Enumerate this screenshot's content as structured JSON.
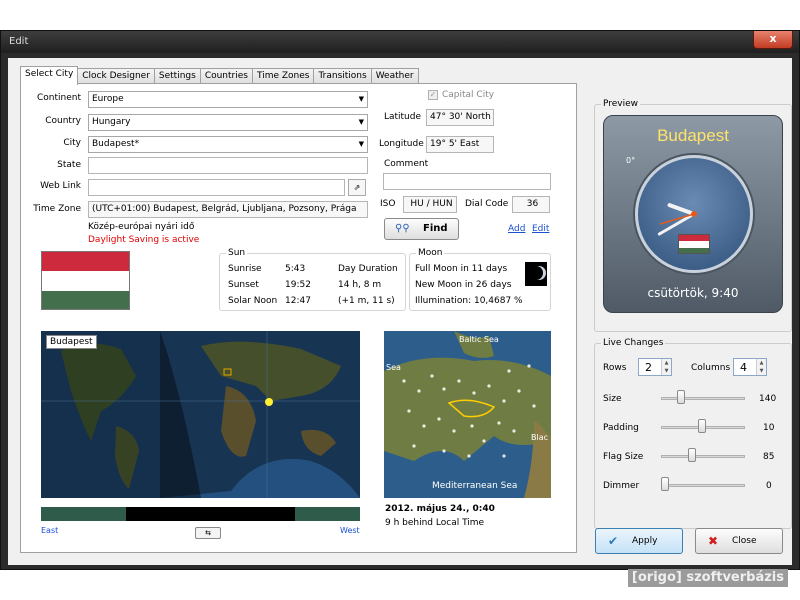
{
  "window": {
    "title": "Edit",
    "close_glyph": "x"
  },
  "tabs": [
    "Select City",
    "Clock Designer",
    "Settings",
    "Countries",
    "Time Zones",
    "Transitions",
    "Weather"
  ],
  "form": {
    "continent_label": "Continent",
    "continent_value": "Europe",
    "country_label": "Country",
    "country_value": "Hungary",
    "city_label": "City",
    "city_value": "Budapest*",
    "state_label": "State",
    "state_value": "",
    "weblink_label": "Web Link",
    "weblink_value": "",
    "timezone_label": "Time Zone",
    "timezone_value": "(UTC+01:00) Budapest, Belgrád, Ljubljana, Pozsony, Prága",
    "tz_name": "Közép-európai nyári idő",
    "dst_text": "Daylight Saving is active",
    "capital_label": "Capital City",
    "latitude_label": "Latitude",
    "latitude_value": "47° 30' North",
    "longitude_label": "Longitude",
    "longitude_value": "19° 5' East",
    "comment_label": "Comment",
    "comment_value": "",
    "iso_label": "ISO",
    "iso_value": "HU / HUN",
    "dialcode_label": "Dial Code",
    "dialcode_value": "36",
    "find_label": "Find",
    "add_label": "Add",
    "edit_label": "Edit"
  },
  "sun": {
    "title": "Sun",
    "sunrise_label": "Sunrise",
    "sunrise": "5:43",
    "sunset_label": "Sunset",
    "sunset": "19:52",
    "noon_label": "Solar Noon",
    "noon": "12:47",
    "duration_label": "Day Duration",
    "duration": "14 h, 8 m",
    "duration_delta": "(+1 m, 11 s)"
  },
  "moon": {
    "title": "Moon",
    "full": "Full Moon in 11 days",
    "new": "New Moon in 26 days",
    "illumination": "Illumination: 10,4687 %"
  },
  "map": {
    "city_tag": "Budapest",
    "east": "East",
    "west": "West",
    "local_labels": {
      "baltic": "Baltic Sea",
      "sea_left": "Sea",
      "black": "Blac",
      "med": "Mediterranean Sea"
    },
    "date_time": "2012. május 24., 0:40",
    "offset": "9 h behind Local Time"
  },
  "preview": {
    "title": "Preview",
    "city": "Budapest",
    "degree": "0°",
    "footer": "csütörtök, 9:40",
    "clock": {
      "hour": 9,
      "minute": 40
    }
  },
  "live": {
    "title": "Live Changes",
    "rows_label": "Rows",
    "rows": "2",
    "columns_label": "Columns",
    "columns": "4",
    "size_label": "Size",
    "size": "140",
    "padding_label": "Padding",
    "padding": "10",
    "flagsize_label": "Flag Size",
    "flagsize": "85",
    "dimmer_label": "Dimmer",
    "dimmer": "0"
  },
  "buttons": {
    "apply": "Apply",
    "close": "Close"
  },
  "watermark": "[origo] szoftverbázis",
  "colors": {
    "hu_red": "#cd2a3e",
    "hu_white": "#ffffff",
    "hu_green": "#436f4d",
    "link": "#1a4fd6",
    "dst_red": "#e00000"
  }
}
